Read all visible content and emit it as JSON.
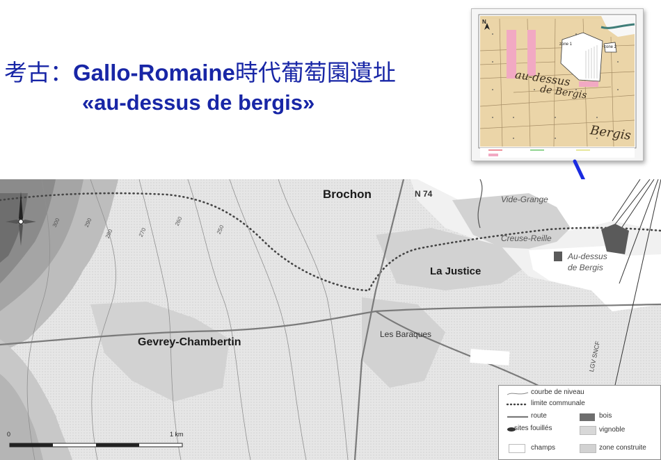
{
  "title": {
    "line1_prefix": "考古：",
    "line1_latin": "Gallo-Romaine",
    "line1_suffix": "時代葡萄園遺址",
    "line2": "«au-dessus de bergis»"
  },
  "map": {
    "places": {
      "brochon": "Brochon",
      "n74": "N 74",
      "vide_grange": "Vide-Grange",
      "creuse_reuille": "Creuse-Reille",
      "la_justice": "La Justice",
      "au_dessus_line1": "Au-dessus",
      "au_dessus_line2": "de Bergis",
      "les_baraques": "Les Baraques",
      "gevrey": "Gevrey-Chambertin",
      "tgv": "LGV SNCF"
    },
    "contours": [
      "250",
      "260",
      "270",
      "280",
      "290",
      "300"
    ],
    "scale": {
      "start": "0",
      "end": "1 km"
    },
    "legend": [
      {
        "label": "courbe de niveau",
        "symbol": "contour"
      },
      {
        "label": "limite communale",
        "symbol": "dotted"
      },
      {
        "label": "route",
        "symbol": "road"
      },
      {
        "label": "bois",
        "symbol": "wood"
      },
      {
        "label": "sites fouillés",
        "symbol": "site"
      },
      {
        "label": "vignoble",
        "symbol": "vineyard"
      },
      {
        "label": "champs",
        "symbol": "field"
      },
      {
        "label": "zone construite",
        "symbol": "built"
      }
    ]
  },
  "inset": {
    "north": "N",
    "cadastre_line1": "au-dessus",
    "cadastre_line2": "de Bergis",
    "cadastre_line3": "Bergis",
    "zone1": "zone 1",
    "zone2": "zone 2"
  },
  "colors": {
    "title": "#1826a6",
    "arrow": "#1a2be0",
    "vineyard": "#e2e2e2",
    "dark_relief": "#6e6e6e",
    "built": "#d2d2d2",
    "site": "#5a5a5a",
    "inset_paper": "#e9d3a4",
    "inset_pink": "#f2a9c3"
  },
  "icons": [
    "compass-rose-icon",
    "north-arrow-icon",
    "pointer-arrow-icon"
  ]
}
